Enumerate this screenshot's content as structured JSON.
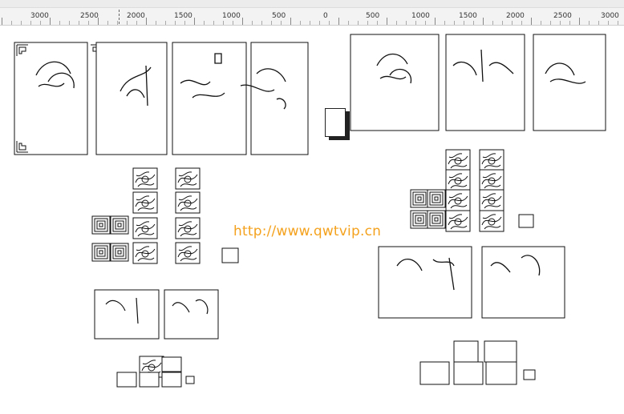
{
  "ruler": {
    "labels": [
      "3000",
      "2500",
      "2000",
      "1500",
      "1000",
      "500",
      "0",
      "500",
      "1000",
      "1500",
      "2000",
      "2500",
      "3000"
    ]
  },
  "watermark": {
    "text": "http://www.qwtvip.cn"
  },
  "colors": {
    "watermark": "#f4a21e",
    "line": "#111111",
    "ruler_bg": "#f3f3f3"
  },
  "icons": {
    "panel_art": "chinese-calligraphy-panel",
    "tile_art": "ornamental-tile",
    "corner": "fret-corner-ornament"
  }
}
